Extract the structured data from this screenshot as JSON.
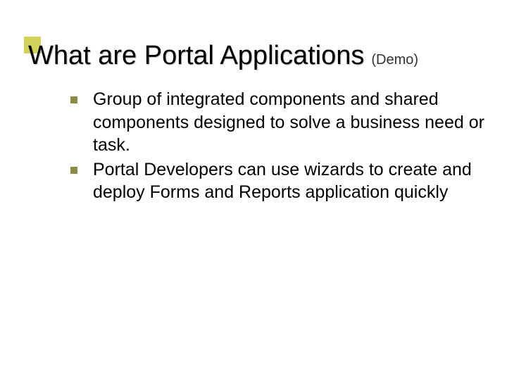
{
  "title": {
    "main": "What are Portal Applications",
    "suffix": "(Demo)"
  },
  "bullets": [
    {
      "text": "Group of integrated components and shared components designed to solve a business need or task."
    },
    {
      "text": "Portal Developers can use wizards to create and deploy Forms and Reports application quickly"
    }
  ]
}
